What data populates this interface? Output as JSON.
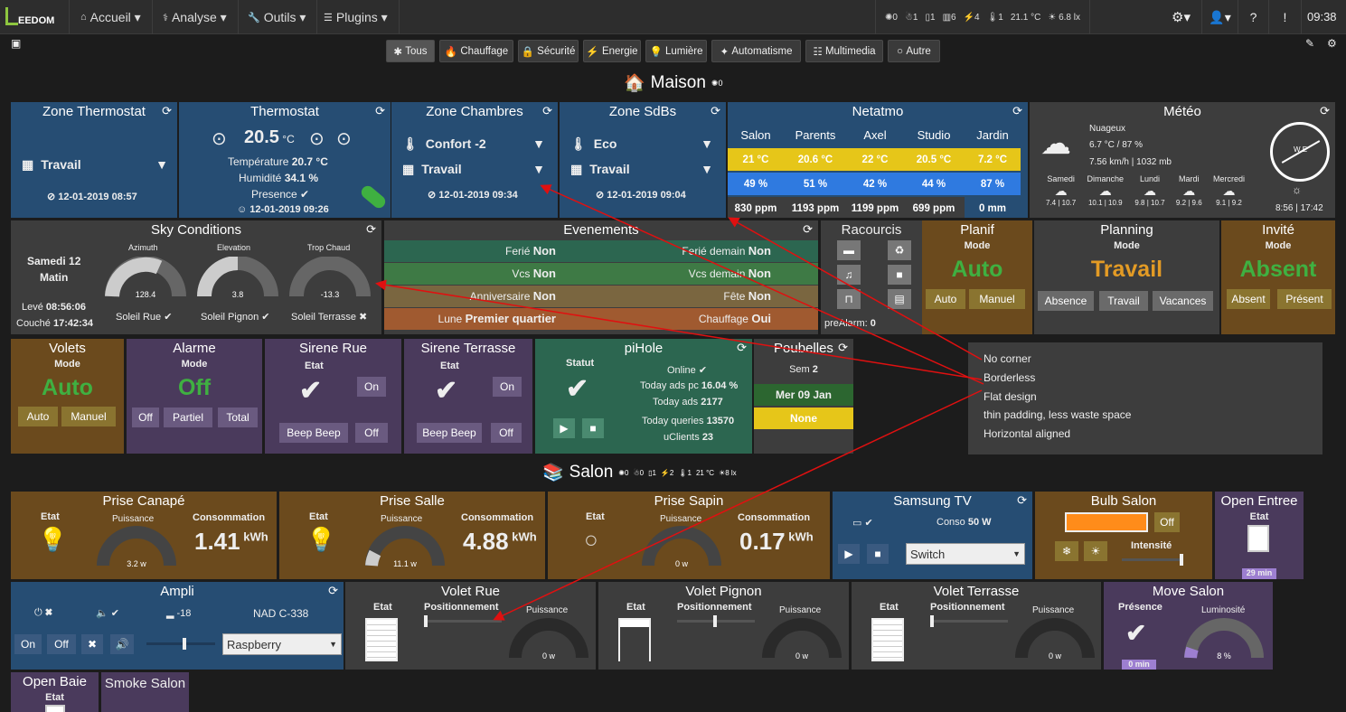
{
  "topbar": {
    "logo": "EEDOM",
    "menu": [
      "Accueil",
      "Analyse",
      "Outils",
      "Plugins"
    ],
    "stats": [
      "0",
      "1",
      "1",
      "6",
      "4",
      "1",
      "21.1 °C",
      "6.8 lx"
    ],
    "time": "09:38"
  },
  "categories": [
    "Tous",
    "Chauffage",
    "Sécurité",
    "Energie",
    "Lumière",
    "Automatisme",
    "Multimedia",
    "Autre"
  ],
  "sections": {
    "maison": "Maison",
    "maison_count": "0",
    "salon": "Salon",
    "salon_stats": [
      "0",
      "0",
      "1",
      "2",
      "1",
      "21 °C",
      "8 lx"
    ]
  },
  "zone_thermostat": {
    "title": "Zone Thermostat",
    "mode": "Travail",
    "date": "12-01-2019 08:57"
  },
  "thermostat": {
    "title": "Thermostat",
    "temp": "20.5",
    "unit": "°C",
    "temp_label": "Température",
    "temp_val": "20.7 °C",
    "hum_label": "Humidité",
    "hum_val": "34.1 %",
    "presence": "Presence",
    "date": "12-01-2019 09:26"
  },
  "zone_chambres": {
    "title": "Zone Chambres",
    "mode1": "Confort -2",
    "mode2": "Travail",
    "date": "12-01-2019 09:34"
  },
  "zone_sdbs": {
    "title": "Zone SdBs",
    "mode1": "Eco",
    "mode2": "Travail",
    "date": "12-01-2019 09:04"
  },
  "netatmo": {
    "title": "Netatmo",
    "cols": [
      "Salon",
      "Parents",
      "Axel",
      "Studio",
      "Jardin"
    ],
    "temp": [
      "21 °C",
      "20.6 °C",
      "22 °C",
      "20.5 °C",
      "7.2 °C"
    ],
    "hum": [
      "49 %",
      "51 %",
      "42 %",
      "44 %",
      "87 %"
    ],
    "co2": [
      "830 ppm",
      "1193 ppm",
      "1199 ppm",
      "699 ppm",
      "0 mm"
    ]
  },
  "meteo": {
    "title": "Météo",
    "cond": "Nuageux",
    "temphum": "6.7 °C / 87 %",
    "wind": "7.56 km/h | 1032 mb",
    "days": [
      "Samedi",
      "Dimanche",
      "Lundi",
      "Mardi",
      "Mercredi"
    ],
    "ranges": [
      "7.4 | 10.7",
      "10.1 | 10.9",
      "9.8 | 10.7",
      "9.2 | 9.6",
      "9.1 | 9.2"
    ],
    "sun": "8:56 | 17:42"
  },
  "sky": {
    "title": "Sky Conditions",
    "day": "Samedi 12",
    "part": "Matin",
    "leve_label": "Levé",
    "leve": "08:56:06",
    "couche_label": "Couché",
    "couche": "17:42:34",
    "g1_label": "Azimuth",
    "g1_val": "128.4",
    "g2_label": "Elevation",
    "g2_val": "3.8",
    "g3_label": "Trop Chaud",
    "g3_val": "-13.3",
    "s1": "Soleil Rue",
    "s2": "Soleil Pignon",
    "s3": "Soleil Terrasse"
  },
  "evenements": {
    "title": "Evenements",
    "rows": [
      [
        "Ferié",
        "Non",
        "Ferié demain",
        "Non"
      ],
      [
        "Vcs",
        "Non",
        "Vcs demain",
        "Non"
      ],
      [
        "Anniversaire",
        "Non",
        "Fête",
        "Non"
      ],
      [
        "Lune",
        "Premier quartier",
        "Chauffage",
        "Oui"
      ]
    ]
  },
  "raccourcis": {
    "title": "Racourcis",
    "prealarm": "preAlarm:",
    "prealarm_val": "0"
  },
  "planif": {
    "title": "Planif",
    "mode": "Mode",
    "val": "Auto",
    "b1": "Auto",
    "b2": "Manuel"
  },
  "planning": {
    "title": "Planning",
    "mode": "Mode",
    "val": "Travail",
    "b1": "Absence",
    "b2": "Travail",
    "b3": "Vacances"
  },
  "invite": {
    "title": "Invité",
    "mode": "Mode",
    "val": "Absent",
    "b1": "Absent",
    "b2": "Présent"
  },
  "volets": {
    "title": "Volets",
    "mode": "Mode",
    "val": "Auto",
    "b1": "Auto",
    "b2": "Manuel"
  },
  "alarme": {
    "title": "Alarme",
    "mode": "Mode",
    "val": "Off",
    "b1": "Off",
    "b2": "Partiel",
    "b3": "Total"
  },
  "sirene_rue": {
    "title": "Sirene Rue",
    "etat": "Etat",
    "on": "On",
    "b1": "Beep Beep",
    "b2": "Off"
  },
  "sirene_terrasse": {
    "title": "Sirene Terrasse",
    "etat": "Etat",
    "on": "On",
    "b1": "Beep Beep",
    "b2": "Off"
  },
  "pihole": {
    "title": "piHole",
    "statut": "Statut",
    "online": "Online",
    "l1": "Today ads pc",
    "v1": "16.04 %",
    "l2": "Today ads",
    "v2": "2177",
    "l3": "Today queries",
    "v3": "13570",
    "l4": "uClients",
    "v4": "23"
  },
  "poubelles": {
    "title": "Poubelles",
    "sem_label": "Sem",
    "sem": "2",
    "date": "Mer 09 Jan",
    "none": "None"
  },
  "annotation": [
    "No corner",
    "Borderless",
    "Flat design",
    "thin padding, less waste space",
    "Horizontal aligned"
  ],
  "prise_canape": {
    "title": "Prise Canapé",
    "etat": "Etat",
    "puissance": "Puissance",
    "conso": "Consommation",
    "w": "3.2 w",
    "kwh": "1.41",
    "unit": "kWh"
  },
  "prise_salle": {
    "title": "Prise Salle",
    "etat": "Etat",
    "puissance": "Puissance",
    "conso": "Consommation",
    "w": "11.1 w",
    "kwh": "4.88",
    "unit": "kWh"
  },
  "prise_sapin": {
    "title": "Prise Sapin",
    "etat": "Etat",
    "puissance": "Puissance",
    "conso": "Consommation",
    "w": "0 w",
    "kwh": "0.17",
    "unit": "kWh"
  },
  "samsung": {
    "title": "Samsung TV",
    "conso_label": "Conso",
    "conso": "50 W",
    "select": "Switch"
  },
  "bulb": {
    "title": "Bulb Salon",
    "off": "Off",
    "intensite": "Intensité",
    "color": "#ff8c1a"
  },
  "open_entree": {
    "title": "Open Entree",
    "etat": "Etat",
    "time": "29 min"
  },
  "ampli": {
    "title": "Ampli",
    "vol": "-18",
    "model": "NAD C-338",
    "b1": "On",
    "b2": "Off",
    "select": "Raspberry"
  },
  "volet_rue": {
    "title": "Volet Rue",
    "etat": "Etat",
    "pos": "Positionnement",
    "puissance": "Puissance",
    "w": "0 w"
  },
  "volet_pignon": {
    "title": "Volet Pignon",
    "etat": "Etat",
    "pos": "Positionnement",
    "puissance": "Puissance",
    "w": "0 w"
  },
  "volet_terrasse": {
    "title": "Volet Terrasse",
    "etat": "Etat",
    "pos": "Positionnement",
    "puissance": "Puissance",
    "w": "0 w"
  },
  "move_salon": {
    "title": "Move Salon",
    "presence": "Présence",
    "lum": "Luminosité",
    "time": "0 min",
    "pct": "8 %"
  },
  "open_baie": {
    "title": "Open Baie",
    "etat": "Etat"
  },
  "smoke": {
    "title": "Smoke Salon"
  },
  "colors": {
    "blue": "#264d73",
    "brown": "#6b4a1d",
    "grey": "#3d3d3d",
    "purple": "#4a3a5c",
    "green": "#2c6650",
    "yellow": "#e6c619",
    "accent_green": "#3fb041",
    "accent_orange": "#e39b25"
  }
}
